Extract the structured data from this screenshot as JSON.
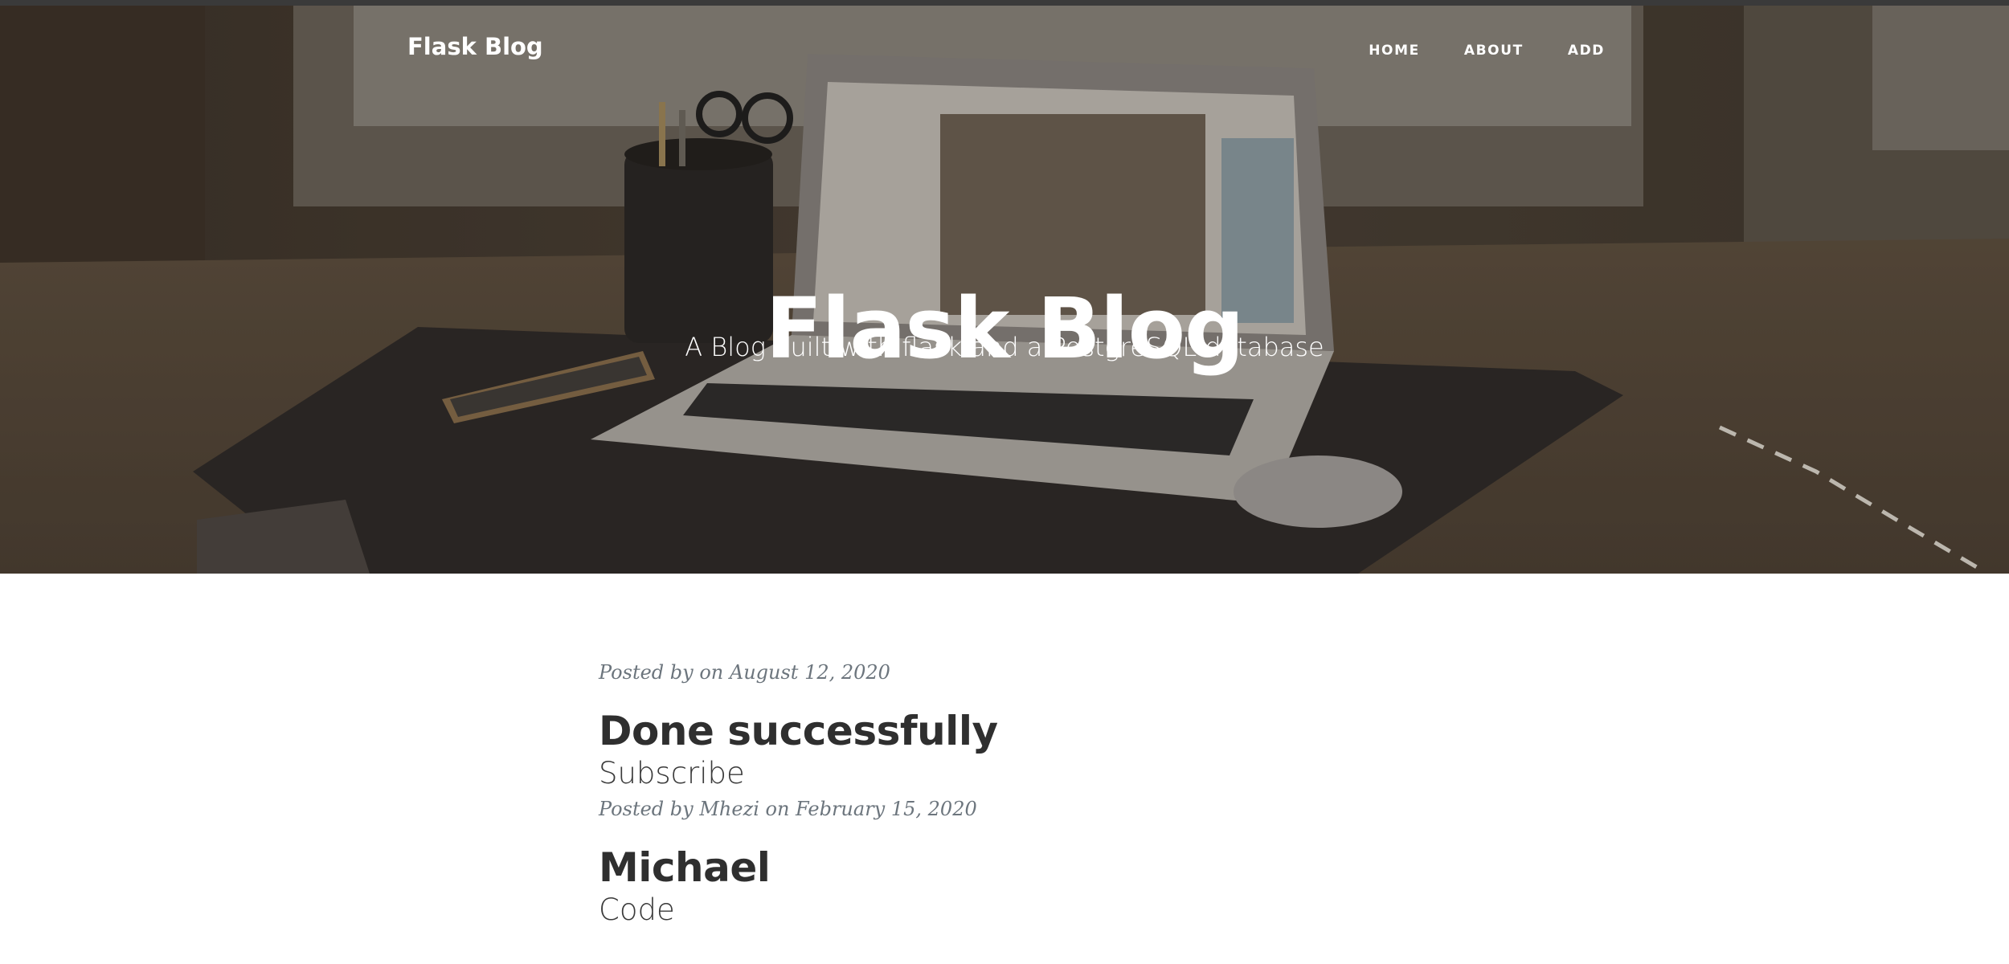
{
  "nav": {
    "brand": "Flask Blog",
    "links": [
      {
        "label": "HOME"
      },
      {
        "label": "ABOUT"
      },
      {
        "label": "ADD"
      }
    ]
  },
  "hero": {
    "title": "Flask Blog",
    "subtitle": "A Blog built with flask and a PostgreSQL database"
  },
  "posts": [
    {
      "meta": "Posted by on August 12, 2020"
    },
    {
      "title": "Done successfully",
      "subtitle": "Subscribe",
      "meta": "Posted by Mhezi on February 15, 2020"
    },
    {
      "title": "Michael",
      "subtitle": "Code"
    }
  ],
  "colors": {
    "hero_overlay": "#2b2621",
    "text_dark": "#2f2f2f",
    "meta_gray": "#6c757d"
  }
}
